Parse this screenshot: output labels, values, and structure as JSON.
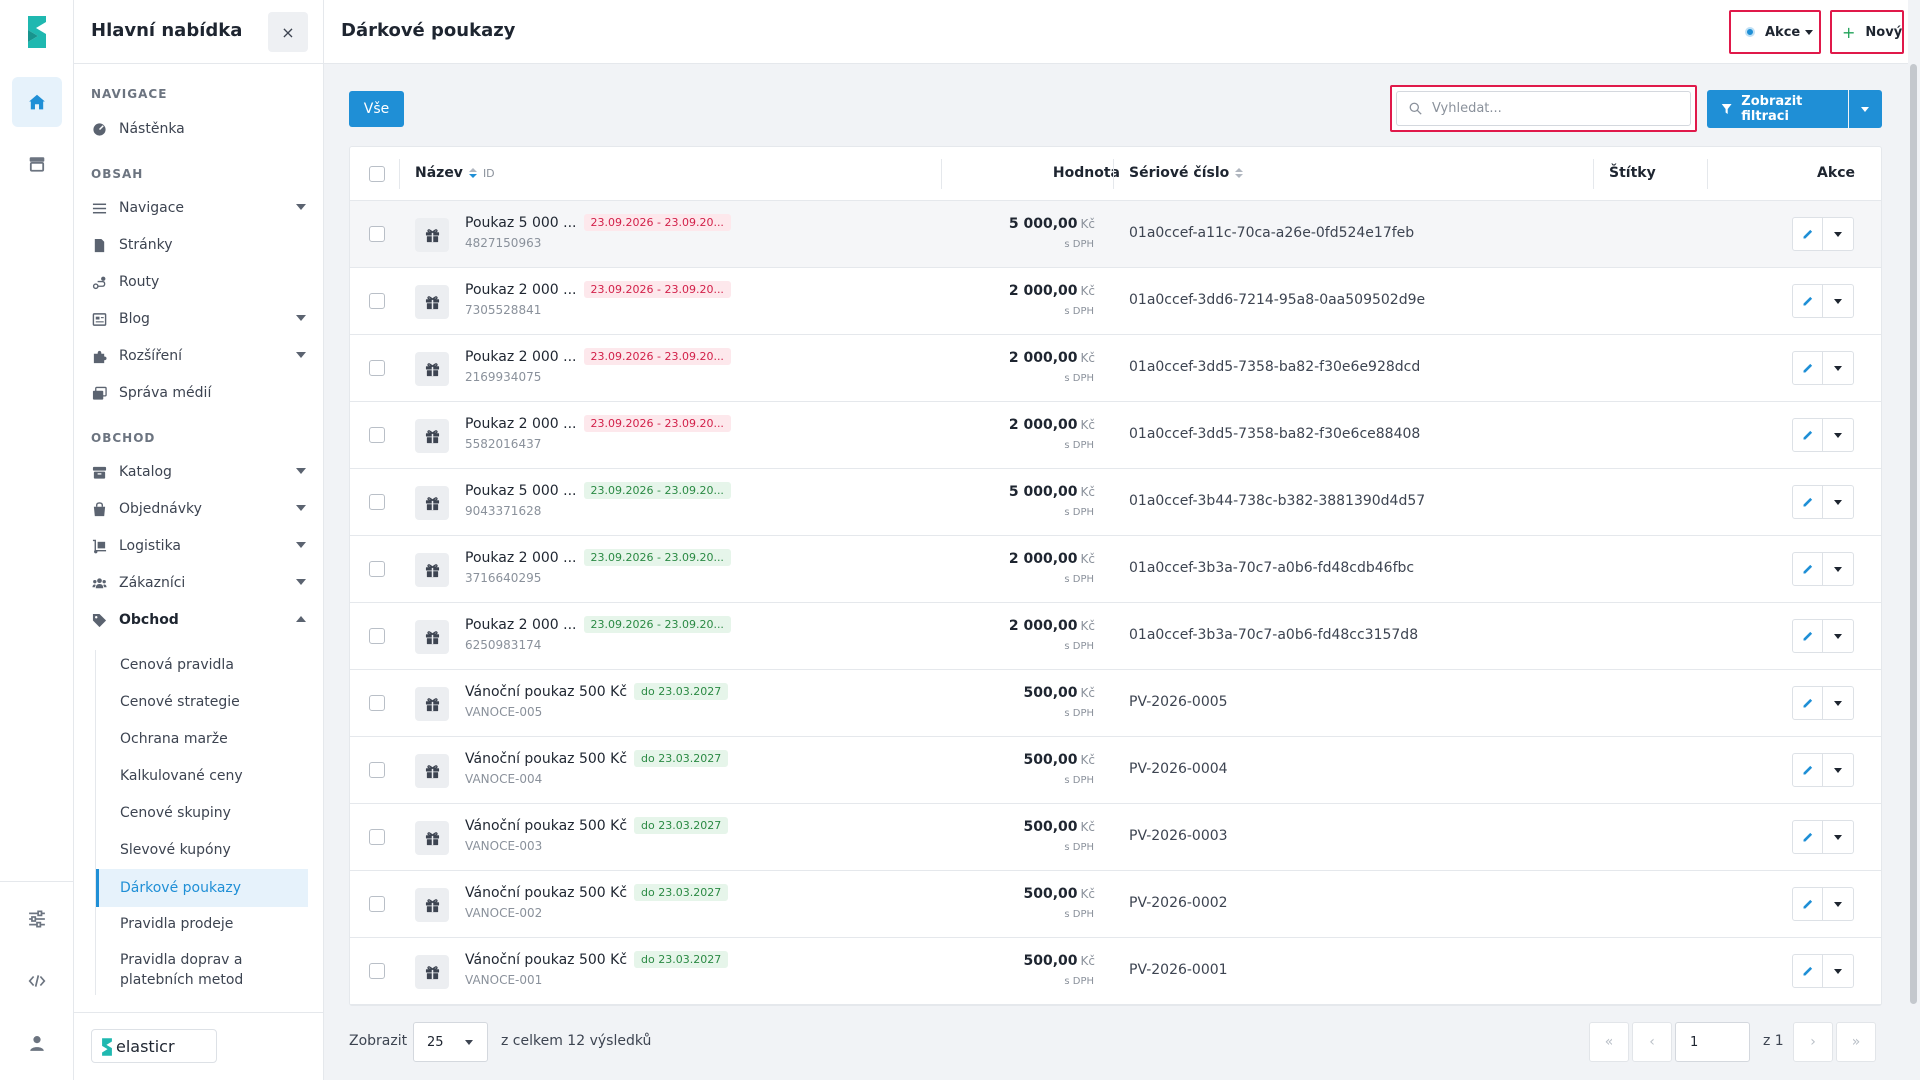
{
  "menu": {
    "title": "Hlavní nabídka",
    "close_label": "×",
    "sections": {
      "navigace": "NAVIGACE",
      "obsah": "OBSAH",
      "obchod": "OBCHOD"
    },
    "items": {
      "nastenka": "Nástěnka",
      "navigace": "Navigace",
      "stranky": "Stránky",
      "routy": "Routy",
      "blog": "Blog",
      "rozsireni": "Rozšíření",
      "sprava_medii": "Správa médií",
      "katalog": "Katalog",
      "objednavky": "Objednávky",
      "logistika": "Logistika",
      "zakaznici": "Zákazníci",
      "obchod": "Obchod"
    },
    "sub_items": [
      "Cenová pravidla",
      "Cenové strategie",
      "Ochrana marže",
      "Kalkulované ceny",
      "Cenové skupiny",
      "Slevové kupóny",
      "Dárkové poukazy",
      "Pravidla prodeje",
      "Pravidla doprav a platebních metod"
    ],
    "active_sub_item": "Dárkové poukazy",
    "brand": "elasticr"
  },
  "header": {
    "title": "Dárkové poukazy",
    "actions_label": "Akce",
    "new_label": "Nový"
  },
  "toolbar": {
    "all_label": "Vše",
    "search_placeholder": "Vyhledat...",
    "filter_label": "Zobrazit filtraci"
  },
  "table": {
    "columns": {
      "name": "Název",
      "id": "ID",
      "value": "Hodnota",
      "serial": "Sériové číslo",
      "tags": "Štítky",
      "actions": "Akce"
    },
    "currency": "Kč",
    "vat_note": "s DPH",
    "rows": [
      {
        "name": "Poukaz 5 000 ...",
        "badge": "23.09.2026 - 23.09.20...",
        "badge_color": "red",
        "code": "4827150963",
        "value": "5 000,00",
        "serial": "01a0ccef-a11c-70ca-a26e-0fd524e17feb"
      },
      {
        "name": "Poukaz 2 000 ...",
        "badge": "23.09.2026 - 23.09.20...",
        "badge_color": "red",
        "code": "7305528841",
        "value": "2 000,00",
        "serial": "01a0ccef-3dd6-7214-95a8-0aa509502d9e"
      },
      {
        "name": "Poukaz 2 000 ...",
        "badge": "23.09.2026 - 23.09.20...",
        "badge_color": "red",
        "code": "2169934075",
        "value": "2 000,00",
        "serial": "01a0ccef-3dd5-7358-ba82-f30e6e928dcd"
      },
      {
        "name": "Poukaz 2 000 ...",
        "badge": "23.09.2026 - 23.09.20...",
        "badge_color": "red",
        "code": "5582016437",
        "value": "2 000,00",
        "serial": "01a0ccef-3dd5-7358-ba82-f30e6ce88408"
      },
      {
        "name": "Poukaz 5 000 ...",
        "badge": "23.09.2026 - 23.09.20...",
        "badge_color": "green",
        "code": "9043371628",
        "value": "5 000,00",
        "serial": "01a0ccef-3b44-738c-b382-3881390d4d57"
      },
      {
        "name": "Poukaz 2 000 ...",
        "badge": "23.09.2026 - 23.09.20...",
        "badge_color": "green",
        "code": "3716640295",
        "value": "2 000,00",
        "serial": "01a0ccef-3b3a-70c7-a0b6-fd48cdb46fbc"
      },
      {
        "name": "Poukaz 2 000 ...",
        "badge": "23.09.2026 - 23.09.20...",
        "badge_color": "green",
        "code": "6250983174",
        "value": "2 000,00",
        "serial": "01a0ccef-3b3a-70c7-a0b6-fd48cc3157d8"
      },
      {
        "name": "Vánoční poukaz 500 Kč",
        "badge": "do 23.03.2027",
        "badge_color": "green",
        "code": "VANOCE-005",
        "value": "500,00",
        "serial": "PV-2026-0005"
      },
      {
        "name": "Vánoční poukaz 500 Kč",
        "badge": "do 23.03.2027",
        "badge_color": "green",
        "code": "VANOCE-004",
        "value": "500,00",
        "serial": "PV-2026-0004"
      },
      {
        "name": "Vánoční poukaz 500 Kč",
        "badge": "do 23.03.2027",
        "badge_color": "green",
        "code": "VANOCE-003",
        "value": "500,00",
        "serial": "PV-2026-0003"
      },
      {
        "name": "Vánoční poukaz 500 Kč",
        "badge": "do 23.03.2027",
        "badge_color": "green",
        "code": "VANOCE-002",
        "value": "500,00",
        "serial": "PV-2026-0002"
      },
      {
        "name": "Vánoční poukaz 500 Kč",
        "badge": "do 23.03.2027",
        "badge_color": "green",
        "code": "VANOCE-001",
        "value": "500,00",
        "serial": "PV-2026-0001"
      }
    ]
  },
  "footer": {
    "show_label": "Zobrazit",
    "per_page": "25",
    "total_label": "z celkem 12 výsledků",
    "first": "«",
    "prev": "‹",
    "page": "1",
    "of_label": "z 1",
    "next": "›",
    "last": "»"
  },
  "colors": {
    "accent": "#1f8fd6",
    "highlight_border": "#e0194a",
    "badge_red": "#d2214a",
    "badge_green": "#2b8a44"
  }
}
